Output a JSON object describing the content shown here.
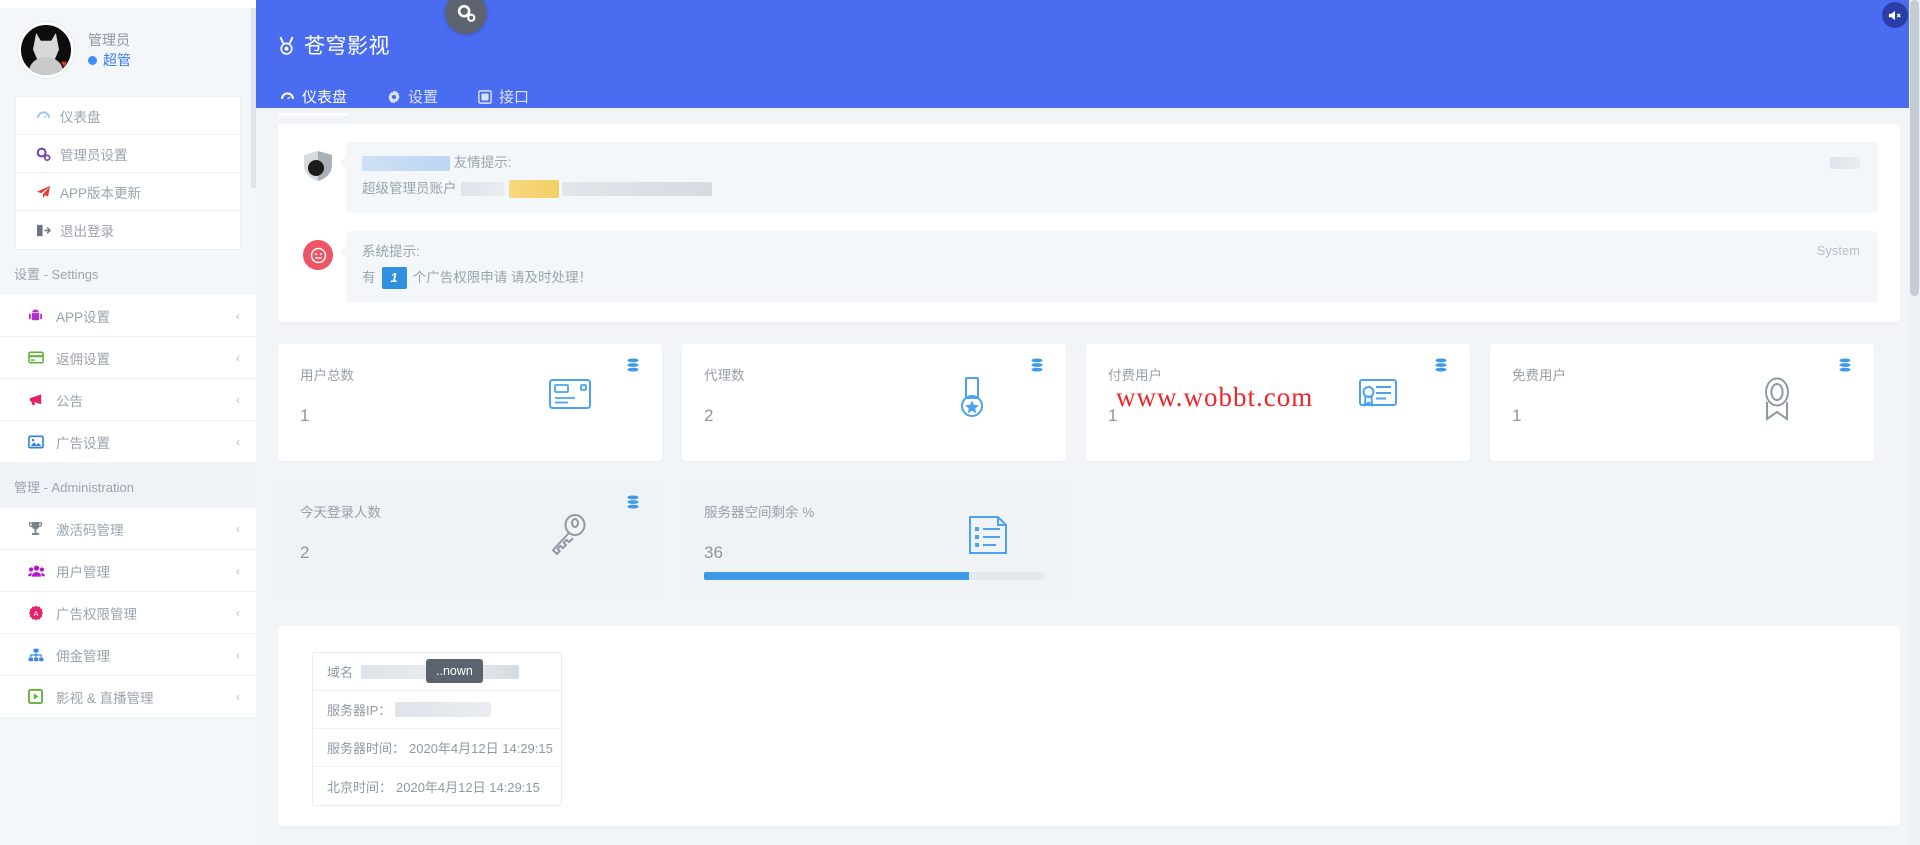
{
  "profile": {
    "name": "管理员",
    "role": "超管",
    "avatar_icon": "dog-avatar"
  },
  "sidebar": {
    "quick_menu": [
      {
        "label": "仪表盘",
        "icon": "dashboard-icon",
        "color": "#a9c6e8"
      },
      {
        "label": "管理员设置",
        "icon": "gears-icon",
        "color": "#7b3fb5"
      },
      {
        "label": "APP版本更新",
        "icon": "paper-plane-icon",
        "color": "#e8392f"
      },
      {
        "label": "退出登录",
        "icon": "logout-icon",
        "color": "#6b7480"
      }
    ],
    "sections": [
      {
        "title": "设置 - Settings",
        "items": [
          {
            "label": "APP设置",
            "icon": "android-icon",
            "color": "#b032c8",
            "arrow": "‹"
          },
          {
            "label": "返佣设置",
            "icon": "credit-card-icon",
            "color": "#63b33b",
            "arrow": "‹"
          },
          {
            "label": "公告",
            "icon": "megaphone-icon",
            "color": "#e81f6a",
            "arrow": "‹"
          },
          {
            "label": "广告设置",
            "icon": "image-icon",
            "color": "#2f7fe0",
            "arrow": "‹"
          }
        ]
      },
      {
        "title": "管理 - Administration",
        "items": [
          {
            "label": "激活码管理",
            "icon": "trophy-icon",
            "color": "#78828d",
            "arrow": "‹"
          },
          {
            "label": "用户管理",
            "icon": "users-icon",
            "color": "#b814d0",
            "arrow": "‹"
          },
          {
            "label": "广告权限管理",
            "icon": "gear-badge-icon",
            "color": "#e81f6a",
            "arrow": "‹"
          },
          {
            "label": "佣金管理",
            "icon": "sitemap-icon",
            "color": "#3b86e8",
            "arrow": "‹"
          },
          {
            "label": "影视 & 直播管理",
            "icon": "play-box-icon",
            "color": "#63b33b",
            "arrow": "‹"
          }
        ]
      }
    ]
  },
  "header": {
    "brand": "苍穹影视",
    "brand_icon": "medal-icon",
    "mute_icon": "speaker-mute-icon",
    "settings_fab_icon": "gears-icon",
    "tabs": [
      {
        "label": "仪表盘",
        "icon": "dashboard-icon",
        "active": true
      },
      {
        "label": "设置",
        "icon": "gear-icon",
        "active": false
      },
      {
        "label": "接口",
        "icon": "api-icon",
        "active": false
      }
    ]
  },
  "notifications": [
    {
      "icon": "shield-avatar",
      "title_redacted": true,
      "title_suffix": "友情提示:",
      "body_prefix": "超级管理员账户",
      "redacted": true,
      "right_label": ""
    },
    {
      "icon": "alert-face-icon",
      "title": "系统提示:",
      "text_before": "有",
      "count": "1",
      "text_after": "个广告权限申请 请及时处理！",
      "right_label": "System"
    }
  ],
  "stats": {
    "row1": [
      {
        "label": "用户总数",
        "value": "1",
        "icon": "envelope-card-icon",
        "stack_icon": "stack-icon"
      },
      {
        "label": "代理数",
        "value": "2",
        "icon": "medal-star-icon",
        "stack_icon": "stack-icon"
      },
      {
        "label": "付费用户",
        "value": "1",
        "icon": "certificate-icon",
        "stack_icon": "stack-icon"
      },
      {
        "label": "免费用户",
        "value": "1",
        "icon": "ribbon-icon",
        "stack_icon": "stack-icon"
      }
    ],
    "row2": [
      {
        "label": "今天登录人数",
        "value": "2",
        "icon": "key-icon",
        "stack_icon": "stack-icon"
      },
      {
        "label": "服务器空间剩余 %",
        "value": "36",
        "icon": "document-list-icon",
        "progress": 78
      }
    ]
  },
  "watermark": "www.wobbt.com",
  "server_info": {
    "rows": [
      {
        "label": "域名",
        "value_redacted": true,
        "tooltip": "..nown"
      },
      {
        "label": "服务器IP：",
        "value_redacted": true
      },
      {
        "label": "服务器时间：",
        "value": "2020年4月12日 14:29:15"
      },
      {
        "label": "北京时间：",
        "value": "2020年4月12日 14:29:15"
      }
    ]
  },
  "colors": {
    "accent": "#4a6cf0",
    "progress": "#3d9ae8",
    "alert": "#ed5565",
    "watermark": "#f0252a"
  }
}
